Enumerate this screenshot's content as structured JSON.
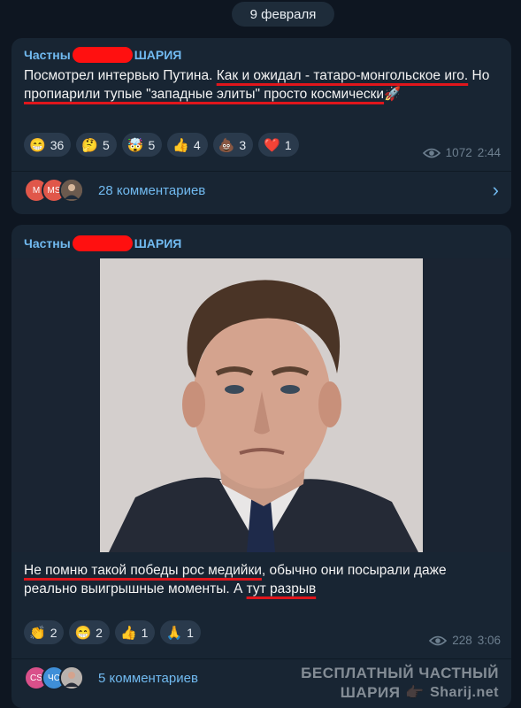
{
  "date": "9 февраля",
  "posts": [
    {
      "channel_prefix": "Частны",
      "channel_suffix": "ШАРИЯ",
      "text_plain": "Посмотрел интервью Путина. ",
      "text_ul1": "Как и ожидал - татаро-монгольское иго.",
      "text_plain2": " Но ",
      "text_ul2": "пропиарили тупые \"западные элиты\" просто космически",
      "text_emoji": "🚀",
      "reactions": [
        {
          "emoji": "😁",
          "count": "36"
        },
        {
          "emoji": "🤔",
          "count": "5"
        },
        {
          "emoji": "🤯",
          "count": "5"
        },
        {
          "emoji": "👍",
          "count": "4"
        },
        {
          "emoji": "💩",
          "count": "3"
        },
        {
          "emoji": "❤️",
          "count": "1"
        }
      ],
      "views": "1072",
      "time": "2:44",
      "avatars": [
        "M",
        "MS"
      ],
      "comments_label": "28 комментариев"
    },
    {
      "channel_prefix": "Частны",
      "channel_suffix": "ШАРИЯ",
      "text_ul1": "Не помню такой победы рос медийки",
      "text_plain": ", обычно они посырали даже реально выигрышные моменты. А ",
      "text_ul2": "тут разрыв",
      "reactions": [
        {
          "emoji": "👏",
          "count": "2"
        },
        {
          "emoji": "😁",
          "count": "2"
        },
        {
          "emoji": "👍",
          "count": "1"
        },
        {
          "emoji": "🙏",
          "count": "1"
        }
      ],
      "views": "228",
      "time": "3:06",
      "avatars": [
        "CS",
        "ЧС"
      ],
      "comments_label": "5 комментариев"
    }
  ],
  "watermark": {
    "line1": "БЕСПЛАТНЫЙ ЧАСТНЫЙ",
    "line2": "ШАРИЯ",
    "hand": "👉🏿",
    "site": "Sharij.net"
  },
  "colors": {
    "background": "#0e1621",
    "bubble": "#182533",
    "accent": "#71baf0",
    "redaction": "#ff1010",
    "underline": "#e0161c"
  }
}
